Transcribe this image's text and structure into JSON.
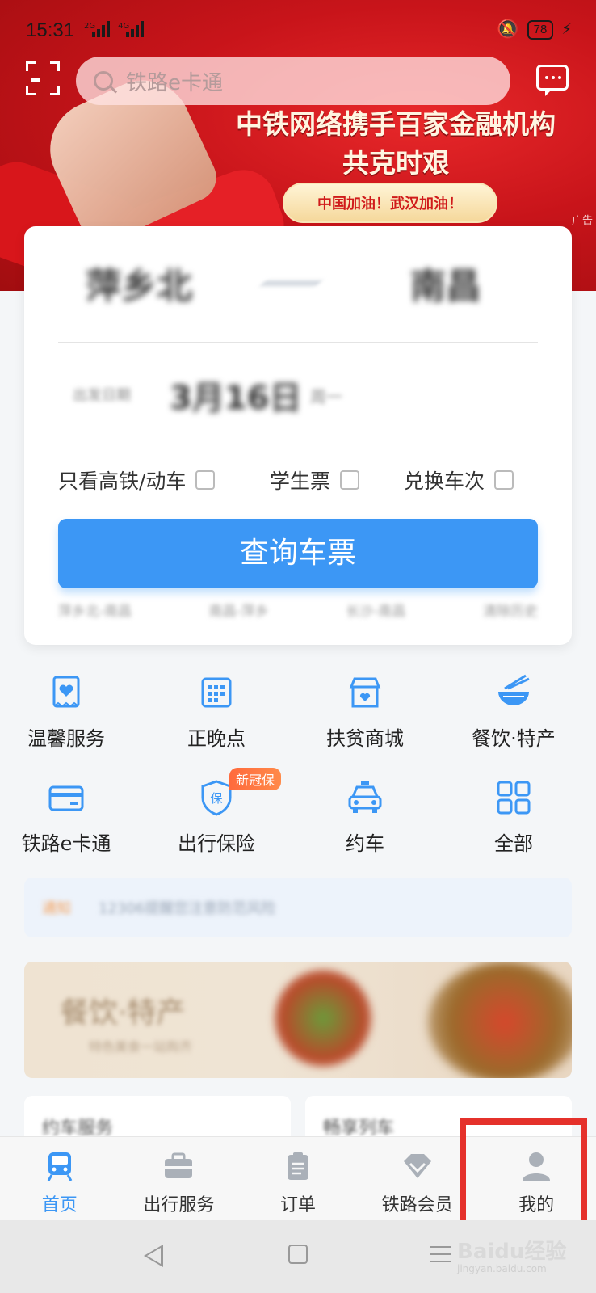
{
  "status": {
    "time": "15:31",
    "net1": "2G",
    "net2": "4G",
    "battery": "78"
  },
  "search": {
    "placeholder": "铁路e卡通"
  },
  "banner": {
    "line1": "中铁网络携手百家金融机构",
    "line2": "共克时艰",
    "pill": "中国加油！武汉加油！",
    "ad": "广告"
  },
  "booking": {
    "from": "萍乡北",
    "to": "南昌",
    "date_label": "出发日期",
    "date": "3月16日",
    "weekday": "周一",
    "options": [
      "只看高铁/动车",
      "学生票",
      "兑换车次"
    ],
    "query_button": "查询车票",
    "history": [
      "萍乡北-南昌",
      "南昌-萍乡",
      "长沙-南昌",
      "清除历史"
    ]
  },
  "services": [
    {
      "label": "温馨服务",
      "icon": "heart-card-icon"
    },
    {
      "label": "正晚点",
      "icon": "calendar-icon"
    },
    {
      "label": "扶贫商城",
      "icon": "shop-icon"
    },
    {
      "label": "餐饮·特产",
      "icon": "noodle-bowl-icon"
    },
    {
      "label": "铁路e卡通",
      "icon": "card-icon"
    },
    {
      "label": "出行保险",
      "icon": "shield-icon",
      "badge": "新冠保"
    },
    {
      "label": "约车",
      "icon": "car-icon"
    },
    {
      "label": "全部",
      "icon": "grid-icon"
    }
  ],
  "notice": {
    "tag": "通知",
    "text": "12306提醒您注意防范风险"
  },
  "promo": {
    "title": "餐饮·特产",
    "subtitle": "特色美食一站购齐"
  },
  "lower_cards": [
    "约车服务",
    "畅享列车"
  ],
  "tabs": [
    {
      "label": "首页",
      "icon": "train-icon",
      "active": true
    },
    {
      "label": "出行服务",
      "icon": "briefcase-icon",
      "active": false
    },
    {
      "label": "订单",
      "icon": "clipboard-icon",
      "active": false
    },
    {
      "label": "铁路会员",
      "icon": "diamond-icon",
      "active": false
    },
    {
      "label": "我的",
      "icon": "person-icon",
      "active": false
    }
  ],
  "watermark": {
    "brand": "Baidu经验",
    "url": "jingyan.baidu.com"
  },
  "colors": {
    "primary": "#3c97f5",
    "banner_red": "#c8141a",
    "highlight": "#e5312b",
    "badge": "#ff6a3d"
  }
}
